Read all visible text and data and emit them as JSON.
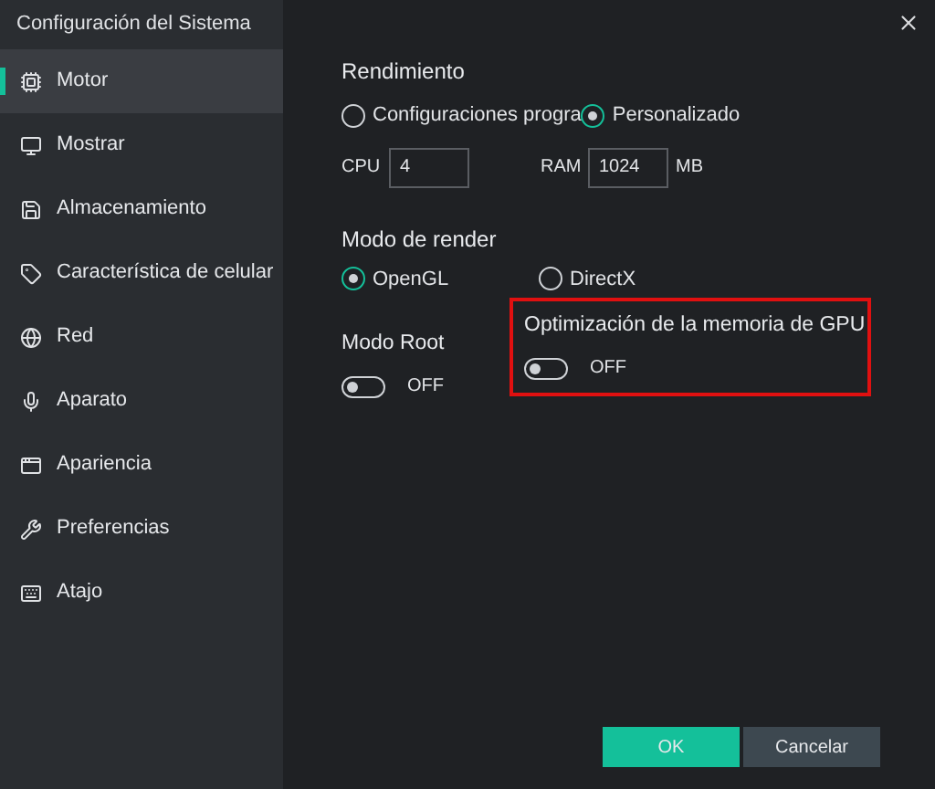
{
  "window": {
    "title": "Configuración del Sistema"
  },
  "sidebar": {
    "items": [
      {
        "label": "Motor",
        "selected": true
      },
      {
        "label": "Mostrar",
        "selected": false
      },
      {
        "label": "Almacenamiento",
        "selected": false
      },
      {
        "label": "Característica de celular",
        "selected": false
      },
      {
        "label": "Red",
        "selected": false
      },
      {
        "label": "Aparato",
        "selected": false
      },
      {
        "label": "Apariencia",
        "selected": false
      },
      {
        "label": "Preferencias",
        "selected": false
      },
      {
        "label": "Atajo",
        "selected": false
      }
    ]
  },
  "performance": {
    "title": "Rendimiento",
    "options": [
      {
        "label": "Configuraciones progra",
        "selected": false
      },
      {
        "label": "Personalizado",
        "selected": true
      }
    ],
    "cpu": {
      "label": "CPU",
      "value": "4"
    },
    "ram": {
      "label": "RAM",
      "value": "1024",
      "unit": "MB"
    }
  },
  "render_mode": {
    "title": "Modo de render",
    "options": [
      {
        "label": "OpenGL",
        "selected": true
      },
      {
        "label": "DirectX",
        "selected": false
      }
    ]
  },
  "toggles": [
    {
      "label": "Modo Root",
      "on": false,
      "state_text": "OFF",
      "highlighted": false
    },
    {
      "label": "Optimización de la memoria de GPU",
      "on": false,
      "state_text": "OFF",
      "highlighted": true
    }
  ],
  "buttons": [
    {
      "label": "OK",
      "kind": "primary"
    },
    {
      "label": "Cancelar",
      "kind": "secondary"
    }
  ]
}
